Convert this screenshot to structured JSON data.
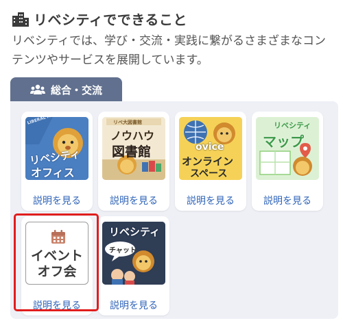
{
  "section": {
    "title": "リベシティでできること",
    "description": "リベシティでは、学び・交流・実践に繋がるさまざまなコンテンツやサービスを展開しています。"
  },
  "tab": {
    "label": "総合・交流",
    "icon": "people-icon"
  },
  "cards": [
    {
      "name": "office",
      "thumb_top": "LIBERAL ARTS CITY",
      "thumb_title": "リベシティ",
      "thumb_sub": "オフィス",
      "link": "説明を見る"
    },
    {
      "name": "library",
      "thumb_top": "リベ大図書館",
      "thumb_title": "ノウハウ",
      "thumb_sub": "図書館",
      "link": "説明を見る"
    },
    {
      "name": "ovice",
      "thumb_top": "ovice",
      "thumb_title": "オンライン",
      "thumb_sub": "スペース",
      "link": "説明を見る"
    },
    {
      "name": "map",
      "thumb_top": "リベシティ",
      "thumb_title": "マップ",
      "thumb_sub": "",
      "link": "説明を見る"
    },
    {
      "name": "event",
      "thumb_title": "イベント",
      "thumb_sub": "オフ会",
      "link": "説明を見る"
    },
    {
      "name": "chat",
      "thumb_top": "リベシティ",
      "thumb_title": "チャット",
      "thumb_sub": "",
      "link": "説明を見る"
    }
  ],
  "colors": {
    "tab_bg": "#61708e",
    "panel_bg": "#eef0f6",
    "link": "#2e63b8",
    "selection": "#e11d1d"
  }
}
